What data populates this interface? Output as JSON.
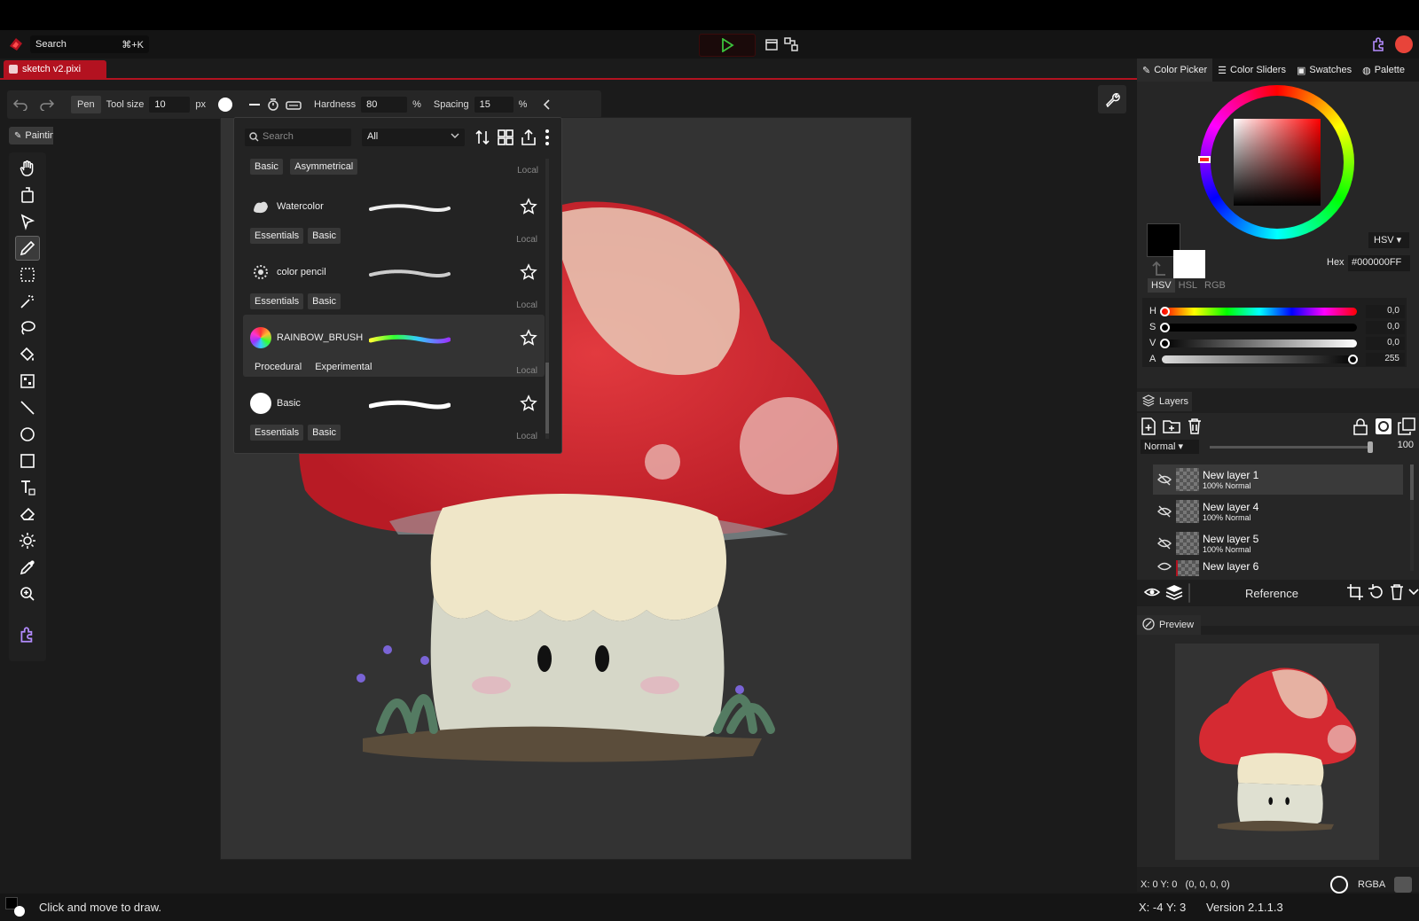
{
  "menubar": {
    "search_label": "Search",
    "search_shortcut": "⌘+K"
  },
  "document_tab": {
    "title": "sketch v2.pixi"
  },
  "toolbar": {
    "pen_label": "Pen",
    "tool_size_label": "Tool size",
    "tool_size_value": "10",
    "tool_size_unit": "px",
    "hardness_label": "Hardness",
    "hardness_value": "80",
    "hardness_unit": "%",
    "spacing_label": "Spacing",
    "spacing_value": "15",
    "spacing_unit": "%"
  },
  "tool_mode": {
    "label": "Painting"
  },
  "brush_panel": {
    "search_placeholder": "Search",
    "filter_value": "All",
    "header_tags": [
      "Basic",
      "Asymmetrical"
    ],
    "header_local": "Local",
    "brushes": [
      {
        "name": "Watercolor",
        "tags": [
          "Essentials",
          "Basic"
        ],
        "source": "Local"
      },
      {
        "name": "color pencil",
        "tags": [
          "Essentials",
          "Basic"
        ],
        "source": "Local"
      },
      {
        "name": "RAINBOW_BRUSH",
        "tags": [
          "Procedural",
          "Experimental"
        ],
        "source": "Local"
      },
      {
        "name": "Basic",
        "tags": [
          "Essentials",
          "Basic"
        ],
        "source": "Local"
      }
    ]
  },
  "right_tabs": [
    "Color Picker",
    "Color Sliders",
    "Swatches",
    "Palette"
  ],
  "color": {
    "mode": "HSV",
    "hex_label": "Hex",
    "hex_value": "#000000FF",
    "model_tabs": [
      "HSV",
      "HSL",
      "RGB"
    ],
    "sliders": [
      {
        "label": "H",
        "value": "0,0"
      },
      {
        "label": "S",
        "value": "0,0"
      },
      {
        "label": "V",
        "value": "0,0"
      },
      {
        "label": "A",
        "value": "255"
      }
    ],
    "primary": "#000000",
    "secondary": "#ffffff"
  },
  "layers": {
    "title": "Layers",
    "blend_mode": "Normal",
    "opacity": "100",
    "items": [
      {
        "name": "New layer 1",
        "meta": "100%  Normal"
      },
      {
        "name": "New layer 4",
        "meta": "100%  Normal"
      },
      {
        "name": "New layer 5",
        "meta": "100%  Normal"
      },
      {
        "name": "New layer 6",
        "meta": ""
      }
    ],
    "reference_label": "Reference"
  },
  "preview": {
    "title": "Preview"
  },
  "info": {
    "cursor_readout": "X: 0 Y: 0   (0, 0, 0, 0)",
    "color_mode": "RGBA"
  },
  "status": {
    "hint": "Click and move to draw.",
    "coords": "X: -4 Y: 3",
    "version": "Version 2.1.1.3"
  },
  "colors": {
    "accent": "#b31220",
    "play": "#3cc23c"
  }
}
